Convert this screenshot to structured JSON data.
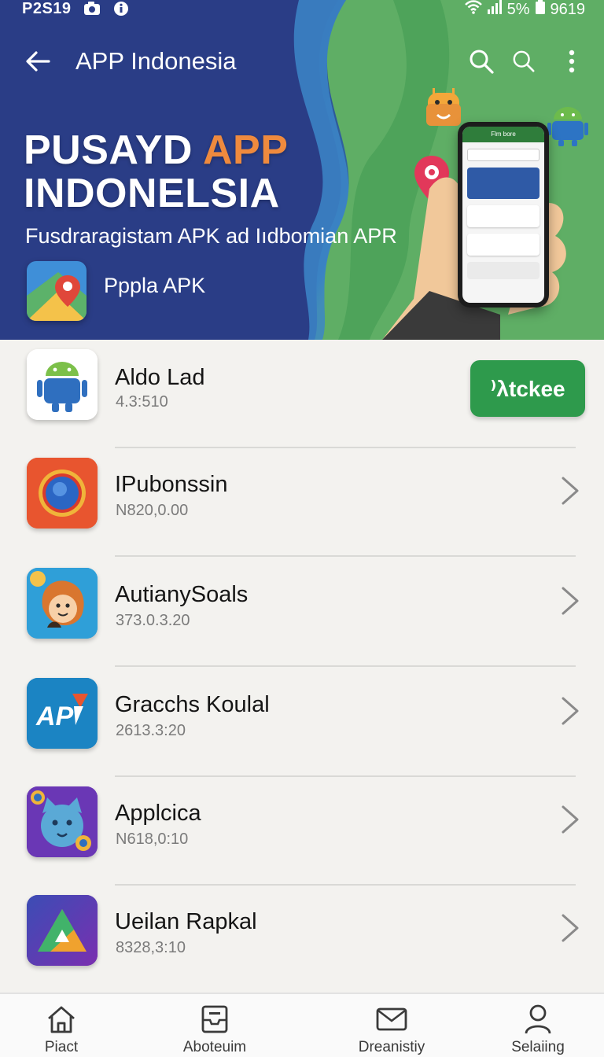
{
  "status_bar": {
    "time": "P2S19",
    "battery_text": "5%",
    "right_time": "9619"
  },
  "toolbar": {
    "title": "APP Indonesia",
    "icons": [
      "back-arrow-icon",
      "search-icon",
      "search-icon",
      "more-vertical-icon"
    ]
  },
  "hero": {
    "title_part1": "PUSAYD ",
    "title_accent": "APP",
    "title_line2": "INDONELSIA",
    "subtitle": "Fusdraragistam APK ad Iıdbomian APR",
    "featured_app_label": "Pppla APK",
    "phone_header": "Flm bore"
  },
  "apps": [
    {
      "name": "Aldo Lad",
      "meta": "4.3:510",
      "action": "install",
      "action_label": "⁾λtckee",
      "icon": "android-robot-icon"
    },
    {
      "name": "IPubonssin",
      "meta": "N820,0.00",
      "action": "chevron",
      "icon": "chrome-style-icon"
    },
    {
      "name": "AutianySoals",
      "meta": "373.0.3.20",
      "action": "chevron",
      "icon": "cartoon-face-icon"
    },
    {
      "name": "Gracchs Koulal",
      "meta": "2613.3:20",
      "action": "chevron",
      "icon": "apk-logo-icon"
    },
    {
      "name": "Applcica",
      "meta": "N618,0:10",
      "action": "chevron",
      "icon": "cat-face-icon"
    },
    {
      "name": "Ueilan Rapkal",
      "meta": "8328,3:10",
      "action": "chevron",
      "icon": "triangle-logo-icon"
    }
  ],
  "bottom_nav": [
    {
      "label": "Piact",
      "icon": "home-icon"
    },
    {
      "label": "Aboteuim",
      "icon": "inbox-tray-icon"
    },
    {
      "label": "Dreanistiy",
      "icon": "mail-icon"
    },
    {
      "label": "Selaiing",
      "icon": "person-icon"
    }
  ],
  "colors": {
    "hero_blue": "#2a3c87",
    "hero_green": "#62b267",
    "accent_orange": "#ef8a3e",
    "install_green": "#2e9a4c",
    "background": "#f3f2ef"
  }
}
